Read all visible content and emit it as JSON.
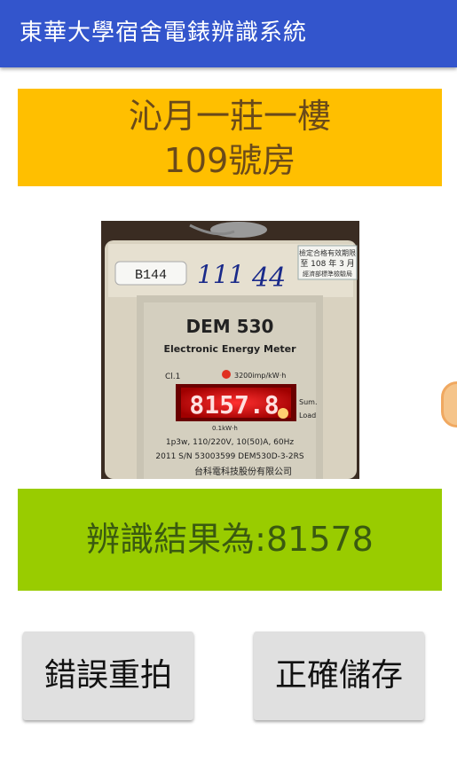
{
  "app": {
    "title": "東華大學宿舍電錶辨識系統",
    "accent": "#3355cc"
  },
  "room": {
    "line1": "沁月一莊一樓",
    "line2": "109號房",
    "color": "#ffbf00"
  },
  "photo": {
    "label_tag": "B144",
    "handwriting_1": "111",
    "handwriting_2": "44",
    "sticker_line1": "檢定合格有效期限",
    "sticker_year": "108",
    "sticker_month": "3",
    "sticker_line2": "至 108 年 3 月",
    "sticker_line3": "經濟部標準檢驗局",
    "model": "DEM 530",
    "subtitle": "Electronic Energy Meter",
    "class_label": "Cl.1",
    "pulse_rate": "3200imp/kW·h",
    "display_value": "8157.8",
    "unit_small": "0.1kW·h",
    "sum_label": "Sum.",
    "load_label": "Load",
    "spec_line": "1p3w, 110/220V, 10(50)A, 60Hz",
    "serial_line": "2011 S/N 53003599 DEM530D-3-2RS",
    "maker": "台科電科技股份有限公司"
  },
  "result": {
    "text": "辨識結果為:81578",
    "color": "#99cc00"
  },
  "buttons": {
    "retake": "錯誤重拍",
    "save": "正確儲存"
  }
}
